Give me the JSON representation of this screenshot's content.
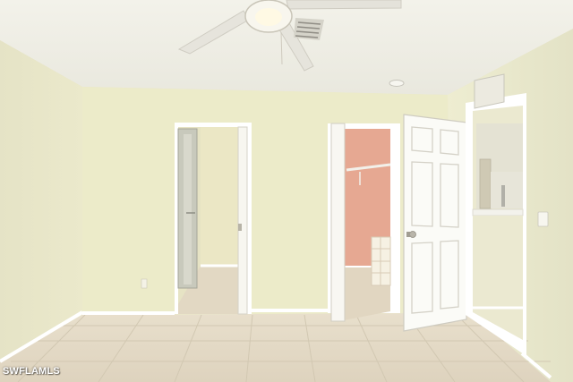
{
  "photo": {
    "watermark": "SWFLAMLS",
    "colors": {
      "wall": "#ecebc8",
      "ceiling": "#f4f3ea",
      "floor": "#e6ddca",
      "trim": "#ffffff",
      "closet_interior": "#e6a892"
    }
  }
}
